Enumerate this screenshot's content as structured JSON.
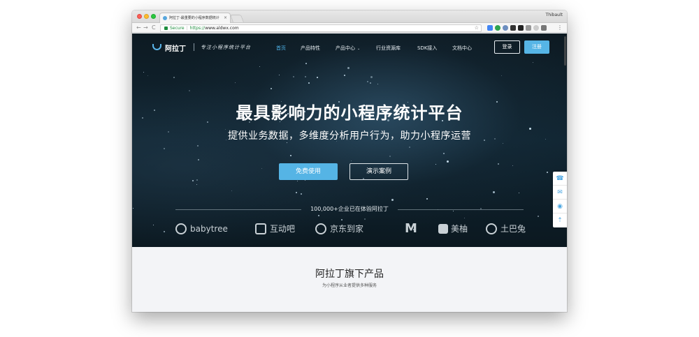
{
  "browser": {
    "tab_title": "阿拉丁-最重要的小程序数据统计",
    "tab_close": "×",
    "profile_name": "Thibault",
    "nav_back": "←",
    "nav_forward": "→",
    "nav_reload": "C",
    "secure_label": "Secure",
    "url_scheme": "https://",
    "url_host": "www.aldwx.com",
    "bookmark_icon": "star-icon",
    "menu_icon": "⋮"
  },
  "site_nav": {
    "logo_text": "阿拉丁",
    "slogan": "专注小程序统计平台",
    "items": [
      {
        "label": "首页",
        "active": true
      },
      {
        "label": "产品特性",
        "active": false
      },
      {
        "label": "产品中心",
        "active": false,
        "dropdown": "⌄"
      },
      {
        "label": "行业资源库",
        "active": false
      },
      {
        "label": "SDK接入",
        "active": false
      },
      {
        "label": "文档中心",
        "active": false
      }
    ],
    "login_label": "登录",
    "register_label": "注册"
  },
  "hero": {
    "title": "最具影响力的小程序统计平台",
    "subtitle": "提供业务数据，多维度分析用户行为，助力小程序运营",
    "primary_cta": "免费使用",
    "secondary_cta": "演示案例",
    "trust_text": "100,000+企业已在体验阿拉丁"
  },
  "partners": [
    {
      "name": "babytree",
      "icon": "babytree-logo"
    },
    {
      "name": "互动吧",
      "icon": "hudongba-logo"
    },
    {
      "name": "京东到家",
      "icon": "jd-daojia-logo"
    },
    {
      "name": "M",
      "icon": "mcdonalds-logo"
    },
    {
      "name": "美柚",
      "icon": "meiyou-logo"
    },
    {
      "name": "土巴兔",
      "icon": "tubatu-logo"
    }
  ],
  "side_tools": [
    {
      "icon": "headset-icon",
      "glyph": "☎"
    },
    {
      "icon": "wechat-icon",
      "glyph": "✉"
    },
    {
      "icon": "qq-icon",
      "glyph": "◉"
    },
    {
      "icon": "back-to-top-icon",
      "glyph": "⇡"
    }
  ],
  "products": {
    "title": "阿拉丁旗下产品",
    "subtitle": "为小程序从业者提供多种服务"
  },
  "colors": {
    "accent": "#56b5e6",
    "hero_bg": "#112633",
    "page_bg": "#f3f4f7"
  }
}
